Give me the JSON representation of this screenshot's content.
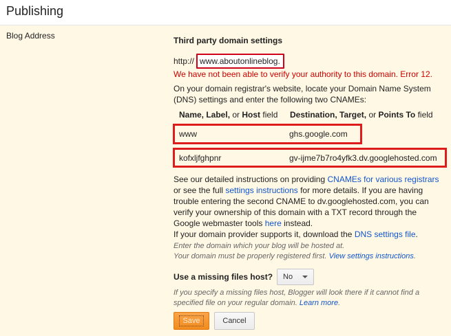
{
  "page": {
    "title": "Publishing"
  },
  "row": {
    "label": "Blog Address"
  },
  "domain_settings": {
    "heading": "Third party domain settings",
    "prefix": "http://",
    "domain_value": "www.aboutonlineblog.",
    "error": "We have not been able to verify your authority to this domain. Error 12.",
    "instructions": "On your domain registrar's website, locate your Domain Name System (DNS) settings and enter the following two CNAMEs:",
    "cname_header": {
      "col1_a": "Name, Label,",
      "col1_or": " or ",
      "col1_b": "Host",
      "col1_c": " field",
      "col2_a": "Destination, Target,",
      "col2_or": " or ",
      "col2_b": "Points To",
      "col2_c": " field"
    },
    "cnames": [
      {
        "name": "www",
        "destination": "ghs.google.com"
      },
      {
        "name": "kofxljfghpnr",
        "destination": "gv-ijme7b7ro4yfk3.dv.googlehosted.com"
      }
    ],
    "help": {
      "t1": "See our detailed instructions on providing ",
      "link1": "CNAMEs for various registrars",
      "t2": " or see the full ",
      "link2": "settings instructions",
      "t3": " for more details. If you are having trouble entering the second CNAME to dv.googlehosted.com, you can verify your ownership of this domain with a TXT record through the Google webmaster tools ",
      "link3": "here",
      "t4": " instead.",
      "t5": "If your domain provider supports it, download the ",
      "link4": "DNS settings file",
      "t6": "."
    },
    "hint": {
      "line1": "Enter the domain which your blog will be hosted at.",
      "line2": "Your domain must be properly registered first. ",
      "link": "View settings instructions",
      "end": "."
    }
  },
  "missing_files": {
    "label": "Use a missing files host?",
    "value": "No",
    "hint_text": "If you specify a missing files host, Blogger will look there if it cannot find a specified file on your regular domain. ",
    "hint_link": "Learn more",
    "hint_end": "."
  },
  "actions": {
    "save": "Save",
    "cancel": "Cancel"
  }
}
